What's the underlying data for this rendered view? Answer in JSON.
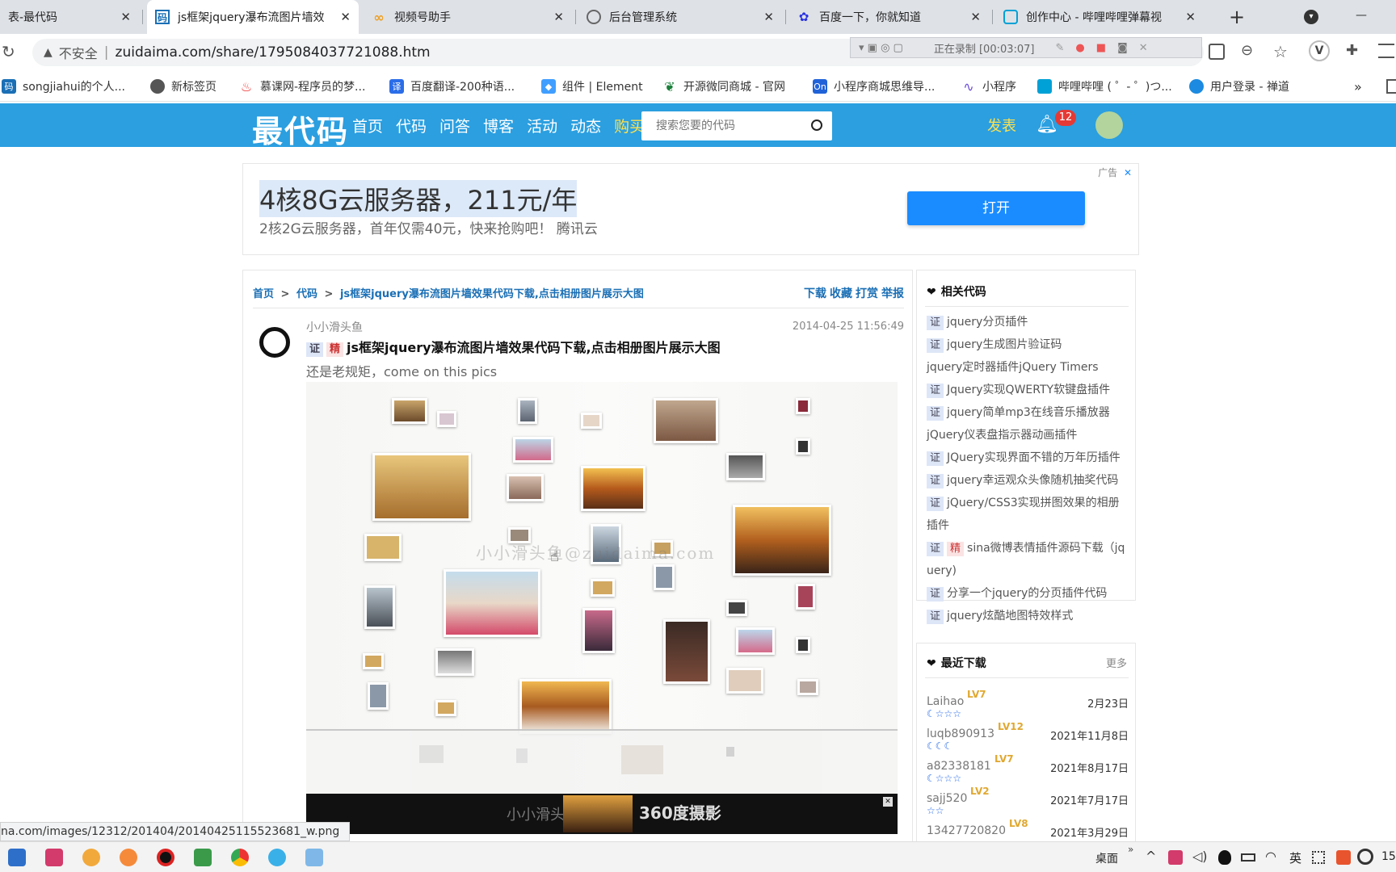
{
  "tabs": [
    {
      "label": "表-最代码",
      "close": "✕",
      "icon": "zuidaima-tab-icon"
    },
    {
      "label": "js框架jquery瀑布流图片墙效",
      "close": "✕",
      "icon": "zuidaima-tab-icon"
    },
    {
      "label": "视频号助手",
      "close": "✕",
      "icon": "weixin-tab-icon"
    },
    {
      "label": "后台管理系统",
      "close": "✕",
      "icon": "globe-icon"
    },
    {
      "label": "百度一下，你就知道",
      "close": "✕",
      "icon": "baidu-paw-icon"
    },
    {
      "label": "创作中心 - 哔哩哔哩弹幕视",
      "close": "✕",
      "icon": "bilibili-tv-icon"
    }
  ],
  "new_tab": "+",
  "minimize": "—",
  "address": {
    "security": "不安全",
    "url": "zuidaima.com/share/1795084037721088.htm",
    "recording": "正在录制 [00:03:07]"
  },
  "bookmarks": [
    {
      "label": "songjiahui的个人..."
    },
    {
      "label": "新标签页"
    },
    {
      "label": "慕课网-程序员的梦..."
    },
    {
      "label": "百度翻译-200种语..."
    },
    {
      "label": "组件 | Element"
    },
    {
      "label": "开源微同商城 - 官网"
    },
    {
      "label": "小程序商城思维导..."
    },
    {
      "label": "小程序"
    },
    {
      "label": "哔哩哔哩 ( ゜- ゜)つ..."
    },
    {
      "label": "用户登录 - 禅道"
    }
  ],
  "bookmarks_more": "»",
  "site": {
    "logo": "最代码",
    "nav": [
      "首页",
      "代码",
      "问答",
      "博客",
      "活动",
      "动态"
    ],
    "buy": "购买",
    "search_placeholder": "搜索您要的代码",
    "publish": "发表",
    "notif_count": "12"
  },
  "ad": {
    "label": "广告",
    "close": "✕",
    "headline": "4核8G云服务器，211元/年",
    "sub": "2核2G云服务器，首年仅需40元，快来抢购吧！ 腾讯云",
    "button": "打开"
  },
  "breadcrumb": {
    "home": "首页",
    "code": "代码",
    "current": "js框架jquery瀑布流图片墙效果代码下载,点击相册图片展示大图",
    "sep": ">"
  },
  "actions": [
    "下载",
    "收藏",
    "打赏",
    "举报"
  ],
  "post": {
    "author": "小小滑头鱼",
    "date": "2014-04-25 11:56:49",
    "badge_zheng": "证",
    "badge_jing": "精",
    "title": "js框架jquery瀑布流图片墙效果代码下载,点击相册图片展示大图",
    "desc": "还是老规矩，come on  this pics"
  },
  "watermark": "小小滑头鱼@zuidaima.com",
  "watermark_bottom": "小小滑头鱼@zui",
  "bottom_banner": "360度摄影",
  "related": {
    "title": "相关代码",
    "items": [
      {
        "z": "证",
        "j": "",
        "text": "jquery分页插件"
      },
      {
        "z": "证",
        "j": "",
        "text": "jquery生成图片验证码"
      },
      {
        "z": "",
        "j": "",
        "text": "jquery定时器插件jQuery Timers"
      },
      {
        "z": "证",
        "j": "",
        "text": "Jquery实现QWERTY软键盘插件"
      },
      {
        "z": "证",
        "j": "",
        "text": "jquery简单mp3在线音乐播放器"
      },
      {
        "z": "",
        "j": "",
        "text": "jQuery仪表盘指示器动画插件"
      },
      {
        "z": "证",
        "j": "",
        "text": "JQuery实现界面不错的万年历插件"
      },
      {
        "z": "证",
        "j": "",
        "text": "jquery幸运观众头像随机抽奖代码"
      },
      {
        "z": "证",
        "j": "",
        "text": "jQuery/CSS3实现拼图效果的相册"
      },
      {
        "z": "",
        "j": "",
        "text": "插件"
      },
      {
        "z": "证",
        "j": "精",
        "text": "sina微博表情插件源码下载（jq"
      },
      {
        "z": "",
        "j": "",
        "text": "uery)"
      },
      {
        "z": "证",
        "j": "",
        "text": "分享一个jquery的分页插件代码"
      },
      {
        "z": "证",
        "j": "",
        "text": "jquery炫酷地图特效样式"
      }
    ]
  },
  "recent": {
    "title": "最近下载",
    "more": "更多",
    "items": [
      {
        "user": "Laihao",
        "lv": "LV7",
        "date": "2月23日",
        "rank": "☾☆☆☆"
      },
      {
        "user": "luqb890913",
        "lv": "LV12",
        "date": "2021年11月8日",
        "rank": "☾☾☾"
      },
      {
        "user": "a82338181",
        "lv": "LV7",
        "date": "2021年8月17日",
        "rank": "☾☆☆☆"
      },
      {
        "user": "sajj520",
        "lv": "LV2",
        "date": "2021年7月17日",
        "rank": "☆☆"
      },
      {
        "user": "13427720820",
        "lv": "LV8",
        "date": "2021年3月29日",
        "rank": ""
      }
    ]
  },
  "status_url": "na.com/images/12312/201404/20140425115523681_w.png",
  "taskbar": {
    "desktop": "桌面",
    "lang": "英",
    "time": "15",
    "more": "»"
  },
  "colors": {
    "nav_bg": "#2b9fe0",
    "link": "#1a6fb5",
    "ad_button": "#1a8cff",
    "yellow": "#ffe14d"
  }
}
